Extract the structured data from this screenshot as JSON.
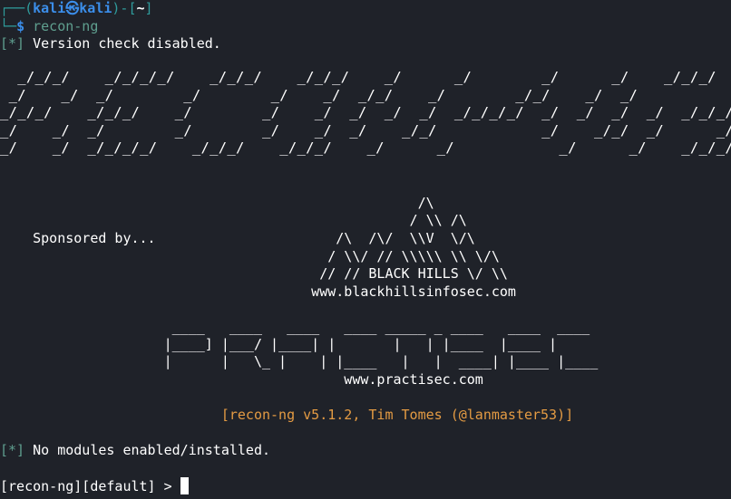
{
  "prompt": {
    "corner_top": "┌──(",
    "user": "kali",
    "at": "㉿",
    "host": "kali",
    "sep": ")-[",
    "cwd": "~",
    "close": "]",
    "corner_bottom": "└─",
    "dollar": "$",
    "command": " recon-ng"
  },
  "messages": {
    "version_tag": "[*]",
    "version_text": " Version check disabled.",
    "modules_tag": "[*]",
    "modules_text": " No modules enabled/installed."
  },
  "banner": {
    "recon_ng_art": "  _/_/_/    _/_/_/_/    _/_/_/    _/_/_/    _/      _/        _/      _/    _/_/_/\n _/    _/  _/        _/        _/    _/  _/_/    _/        _/_/    _/  _/\n_/_/_/    _/_/_/    _/        _/    _/  _/  _/  _/  _/_/_/_/  _/  _/  _/  _/  _/_/_/\n_/    _/  _/        _/        _/    _/  _/    _/_/            _/    _/_/  _/      _/\n_/    _/  _/_/_/_/    _/_/_/    _/_/_/    _/      _/            _/      _/    _/_/_/"
  },
  "sponsor1": {
    "label": "    Sponsored by...",
    "art_1": "                                                   /\\",
    "art_2": "                                                  / \\\\ /\\",
    "art_3": "                                         /\\  /\\/  \\\\V  \\/\\",
    "art_4": "                                        / \\\\/ // \\\\\\\\\\ \\\\ \\/\\",
    "art_5": "                                       // // BLACK HILLS \\/ \\\\",
    "url": "                                      www.blackhillsinfosec.com"
  },
  "sponsor2": {
    "art_1": "                     ____   ____   ____   ____ _____ _ ____   ____  ____",
    "art_2": "                    |____] |___/ |____| |       |   | |____  |____ |",
    "art_3": "                    |      |   \\_ |    | |____   |   |  ____| |____ |____",
    "url": "                                          www.practisec.com"
  },
  "version_line": "                           [recon-ng v5.1.2, Tim Tomes (@lanmaster53)]",
  "repl_prompt": "[recon-ng][default] > "
}
